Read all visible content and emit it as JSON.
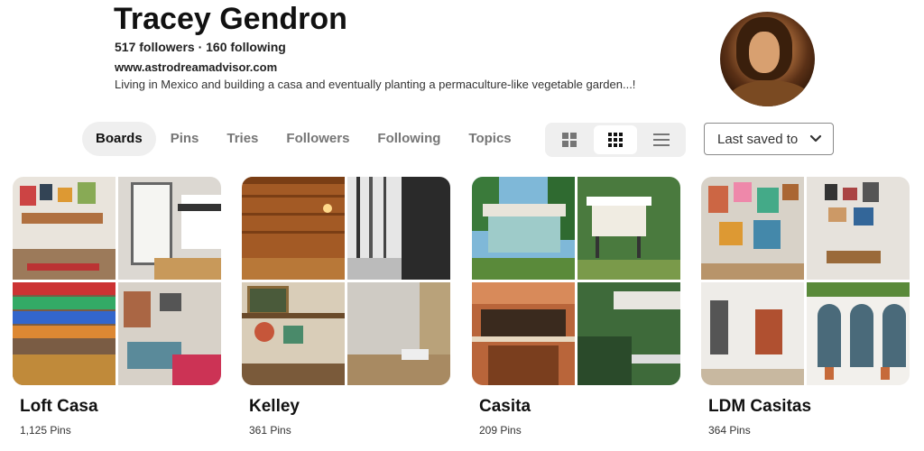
{
  "profile": {
    "name": "Tracey Gendron",
    "stats": "517 followers · 160 following",
    "website": "www.astrodreamadvisor.com",
    "bio": "Living in Mexico and building a casa and eventually planting a permaculture-like vegetable garden...!"
  },
  "tabs": [
    {
      "label": "Boards",
      "active": true
    },
    {
      "label": "Pins"
    },
    {
      "label": "Tries"
    },
    {
      "label": "Followers"
    },
    {
      "label": "Following"
    },
    {
      "label": "Topics"
    }
  ],
  "view_options": [
    "grid-large-icon",
    "grid-compact-icon",
    "list-icon"
  ],
  "sort": {
    "label": "Last saved to",
    "icon": "chevron-down-icon"
  },
  "boards": [
    {
      "title": "Loft Casa",
      "count": "1,125 Pins"
    },
    {
      "title": "Kelley",
      "count": "361 Pins"
    },
    {
      "title": "Casita",
      "count": "209 Pins"
    },
    {
      "title": "LDM Casitas",
      "count": "364 Pins"
    }
  ],
  "colors": {
    "tab_active_bg": "#efefef",
    "text_muted": "#767676"
  }
}
